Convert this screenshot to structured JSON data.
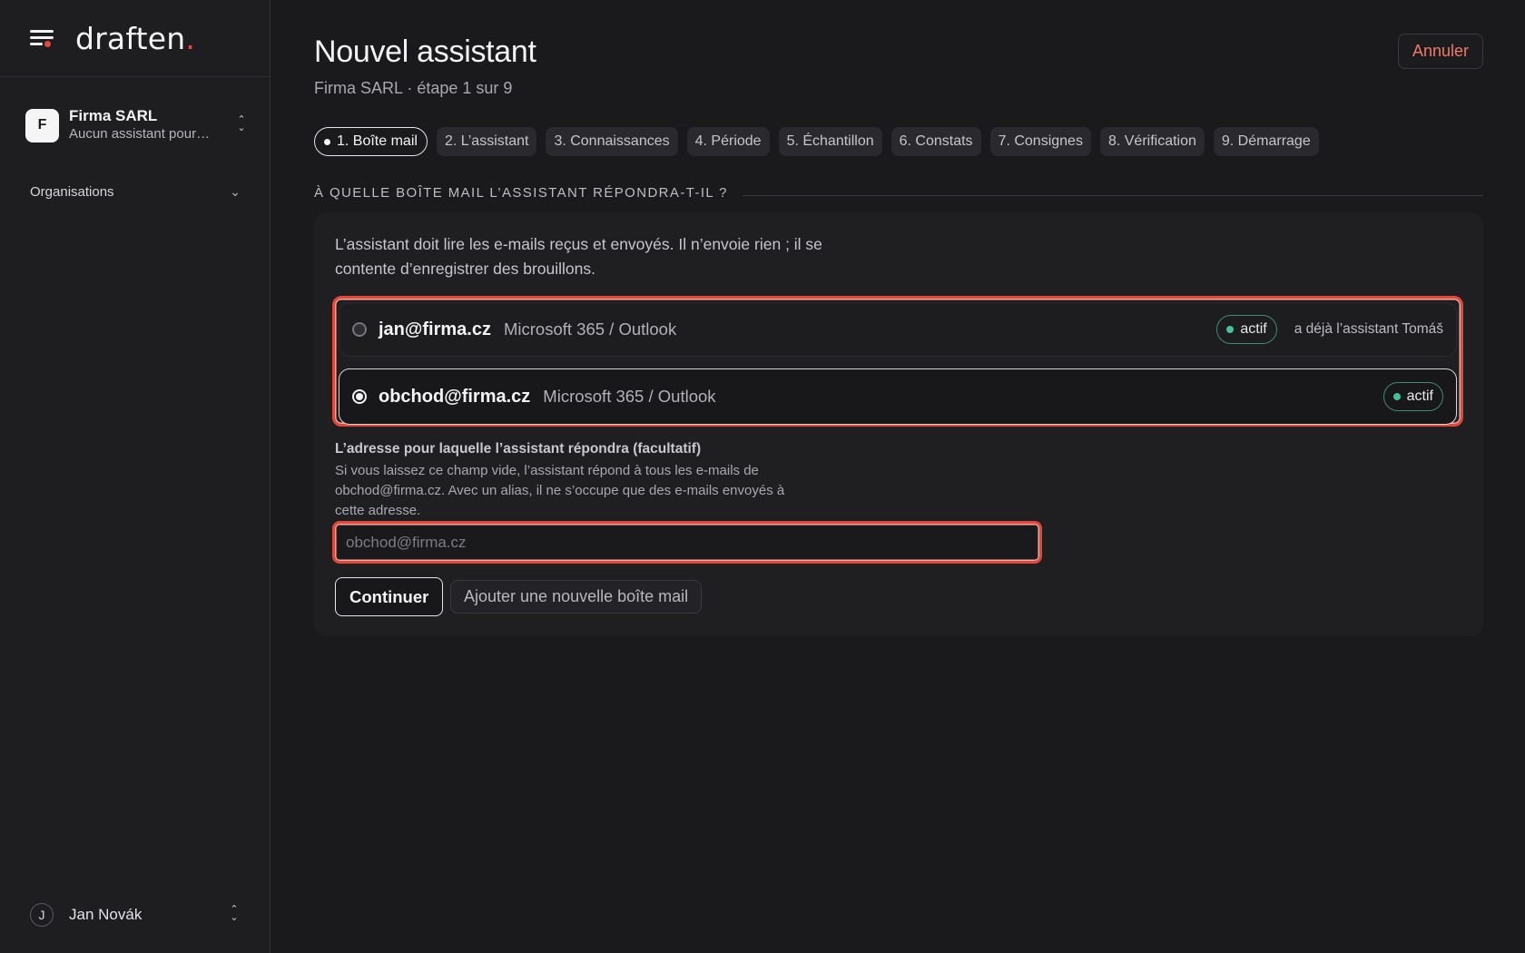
{
  "app": {
    "logo_text": "draften",
    "logo_dot": "."
  },
  "sidebar": {
    "org": {
      "initial": "F",
      "name": "Firma SARL",
      "subtitle": "Aucun assistant pour…"
    },
    "organisations_label": "Organisations",
    "user": {
      "initial": "J",
      "name": "Jan Novák"
    }
  },
  "header": {
    "title": "Nouvel assistant",
    "subtitle": "Firma SARL · étape 1 sur 9",
    "cancel_label": "Annuler"
  },
  "steps": [
    {
      "label": "1. Boîte mail",
      "active": true
    },
    {
      "label": "2. L’assistant"
    },
    {
      "label": "3. Connaissances"
    },
    {
      "label": "4. Période"
    },
    {
      "label": "5. Échantillon"
    },
    {
      "label": "6. Constats"
    },
    {
      "label": "7. Consignes"
    },
    {
      "label": "8. Vérification"
    },
    {
      "label": "9. Démarrage"
    }
  ],
  "section_title": "À QUELLE BOÎTE MAIL L’ASSISTANT RÉPONDRA-T-IL ?",
  "panel": {
    "intro": "L’assistant doit lire les e-mails reçus et envoyés. Il n’envoie rien ; il se contente d’enregistrer des brouillons.",
    "mailboxes": [
      {
        "email": "jan@firma.cz",
        "provider": "Microsoft 365 / Outlook",
        "status": "actif",
        "note": "a déjà l’assistant Tomáš",
        "selected": false
      },
      {
        "email": "obchod@firma.cz",
        "provider": "Microsoft 365 / Outlook",
        "status": "actif",
        "note": "",
        "selected": true
      }
    ],
    "alias": {
      "label": "L’adresse pour laquelle l’assistant répondra (facultatif)",
      "help": "Si vous laissez ce champ vide, l’assistant répond à tous les e-mails de obchod@firma.cz. Avec un alias, il ne s’occupe que des e-mails envoyés à cette adresse.",
      "placeholder": "obchod@firma.cz",
      "value": ""
    },
    "continue_label": "Continuer",
    "add_mailbox_label": "Ajouter une nouvelle boîte mail"
  },
  "colors": {
    "accent": "#e8473b",
    "status_green": "#3fc39a",
    "background": "#1a191c"
  }
}
